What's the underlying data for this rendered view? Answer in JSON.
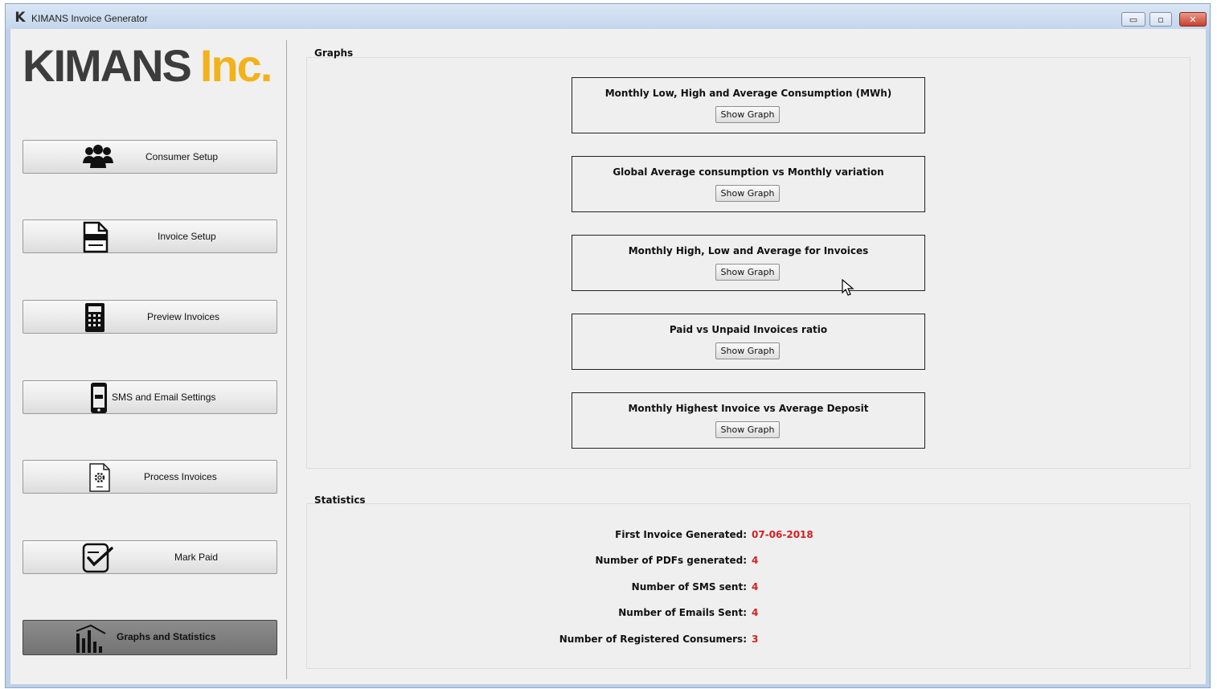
{
  "window": {
    "title": "KIMANS Invoice Generator",
    "app_icon_letter": "K",
    "controls": {
      "minimize": "▭",
      "maximize": "▫",
      "close": "✕"
    }
  },
  "logo": {
    "main": "KIMANS",
    "accent": "Inc.",
    "accent_color": "#f3b21b",
    "main_color": "#3c3c3c"
  },
  "sidebar": {
    "items": [
      {
        "label": "Consumer Setup",
        "icon": "users-icon"
      },
      {
        "label": "Invoice Setup",
        "icon": "invoice-document-icon"
      },
      {
        "label": "Preview Invoices",
        "icon": "calculator-icon"
      },
      {
        "label": "SMS and Email Settings",
        "icon": "mobile-sms-icon"
      },
      {
        "label": "Process Invoices",
        "icon": "gear-document-icon"
      },
      {
        "label": "Mark Paid",
        "icon": "checkmark-document-icon"
      },
      {
        "label": "Graphs and Statistics",
        "icon": "bar-chart-icon",
        "active": true
      }
    ]
  },
  "graphs": {
    "title": "Graphs",
    "items": [
      {
        "title": "Monthly Low, High and Average Consumption (MWh)",
        "button": "Show Graph"
      },
      {
        "title": "Global Average consumption vs Monthly variation",
        "button": "Show Graph"
      },
      {
        "title": "Monthly High, Low and Average for Invoices",
        "button": "Show Graph"
      },
      {
        "title": "Paid vs Unpaid Invoices ratio",
        "button": "Show Graph"
      },
      {
        "title": "Monthly Highest Invoice vs Average Deposit",
        "button": "Show Graph"
      }
    ]
  },
  "statistics": {
    "title": "Statistics",
    "value_color": "#d42020",
    "rows": [
      {
        "label": "First Invoice Generated:",
        "value": "07-06-2018"
      },
      {
        "label": "Number of PDFs generated:",
        "value": "4"
      },
      {
        "label": "Number of SMS sent:",
        "value": "4"
      },
      {
        "label": "Number of Emails Sent:",
        "value": "4"
      },
      {
        "label": "Number of Registered Consumers:",
        "value": "3"
      }
    ]
  }
}
